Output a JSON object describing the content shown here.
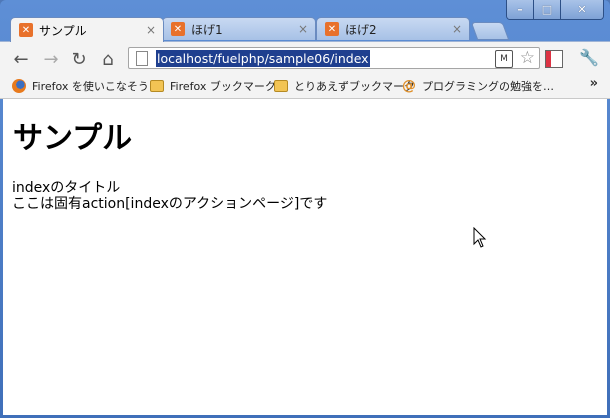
{
  "window": {
    "controls": {
      "minimize": "–",
      "maximize": "□",
      "close": "✕"
    }
  },
  "tabs": [
    {
      "label": "サンプル",
      "active": true,
      "close": "×"
    },
    {
      "label": "ほげ1",
      "active": false,
      "close": "×"
    },
    {
      "label": "ほげ2",
      "active": false,
      "close": "×"
    }
  ],
  "toolbar": {
    "back_icon": "←",
    "forward_icon": "→",
    "reload_icon": "↻",
    "home_icon": "⌂",
    "url": "localhost/fuelphp/sample06/index",
    "star_icon": "☆",
    "wrench_icon": "🔧"
  },
  "bookmarks": [
    {
      "label": "Firefox を使いこなそう",
      "icon": "firefox-icon"
    },
    {
      "label": "Firefox ブックマーク",
      "icon": "folder-icon"
    },
    {
      "label": "とりあえずブックマーク",
      "icon": "folder-icon"
    },
    {
      "label": "プログラミングの勉強を…",
      "icon": "at-icon"
    }
  ],
  "bookmarks_overflow": "»",
  "page": {
    "heading": "サンプル",
    "lines": [
      "indexのタイトル",
      "ここは固有action[indexのアクションページ]です"
    ]
  },
  "colors": {
    "frame": "#4f78b8",
    "selection": "#1f3f8f",
    "tab_active": "#f3f3f3"
  }
}
